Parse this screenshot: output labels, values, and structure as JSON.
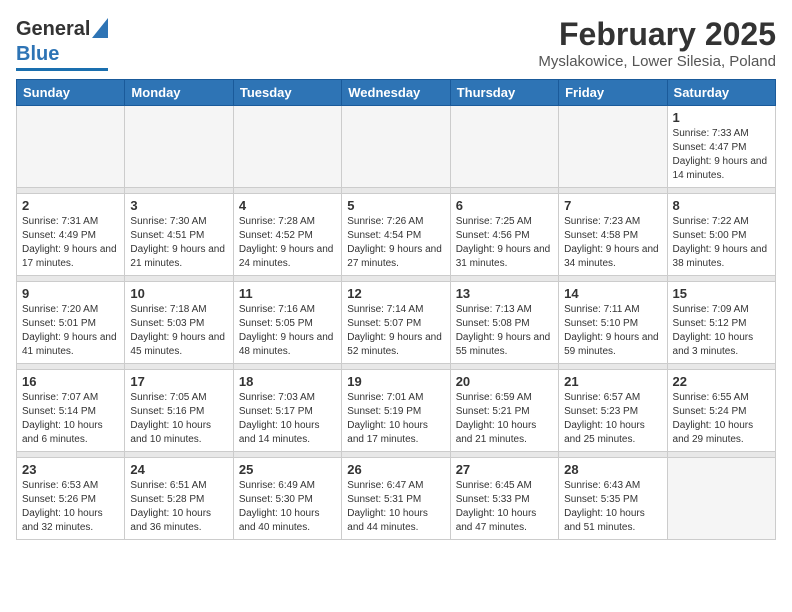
{
  "header": {
    "logo_line1": "General",
    "logo_line2": "Blue",
    "title": "February 2025",
    "subtitle": "Myslakowice, Lower Silesia, Poland"
  },
  "days_of_week": [
    "Sunday",
    "Monday",
    "Tuesday",
    "Wednesday",
    "Thursday",
    "Friday",
    "Saturday"
  ],
  "weeks": [
    [
      {
        "day": "",
        "info": ""
      },
      {
        "day": "",
        "info": ""
      },
      {
        "day": "",
        "info": ""
      },
      {
        "day": "",
        "info": ""
      },
      {
        "day": "",
        "info": ""
      },
      {
        "day": "",
        "info": ""
      },
      {
        "day": "1",
        "info": "Sunrise: 7:33 AM\nSunset: 4:47 PM\nDaylight: 9 hours and 14 minutes."
      }
    ],
    [
      {
        "day": "2",
        "info": "Sunrise: 7:31 AM\nSunset: 4:49 PM\nDaylight: 9 hours and 17 minutes."
      },
      {
        "day": "3",
        "info": "Sunrise: 7:30 AM\nSunset: 4:51 PM\nDaylight: 9 hours and 21 minutes."
      },
      {
        "day": "4",
        "info": "Sunrise: 7:28 AM\nSunset: 4:52 PM\nDaylight: 9 hours and 24 minutes."
      },
      {
        "day": "5",
        "info": "Sunrise: 7:26 AM\nSunset: 4:54 PM\nDaylight: 9 hours and 27 minutes."
      },
      {
        "day": "6",
        "info": "Sunrise: 7:25 AM\nSunset: 4:56 PM\nDaylight: 9 hours and 31 minutes."
      },
      {
        "day": "7",
        "info": "Sunrise: 7:23 AM\nSunset: 4:58 PM\nDaylight: 9 hours and 34 minutes."
      },
      {
        "day": "8",
        "info": "Sunrise: 7:22 AM\nSunset: 5:00 PM\nDaylight: 9 hours and 38 minutes."
      }
    ],
    [
      {
        "day": "9",
        "info": "Sunrise: 7:20 AM\nSunset: 5:01 PM\nDaylight: 9 hours and 41 minutes."
      },
      {
        "day": "10",
        "info": "Sunrise: 7:18 AM\nSunset: 5:03 PM\nDaylight: 9 hours and 45 minutes."
      },
      {
        "day": "11",
        "info": "Sunrise: 7:16 AM\nSunset: 5:05 PM\nDaylight: 9 hours and 48 minutes."
      },
      {
        "day": "12",
        "info": "Sunrise: 7:14 AM\nSunset: 5:07 PM\nDaylight: 9 hours and 52 minutes."
      },
      {
        "day": "13",
        "info": "Sunrise: 7:13 AM\nSunset: 5:08 PM\nDaylight: 9 hours and 55 minutes."
      },
      {
        "day": "14",
        "info": "Sunrise: 7:11 AM\nSunset: 5:10 PM\nDaylight: 9 hours and 59 minutes."
      },
      {
        "day": "15",
        "info": "Sunrise: 7:09 AM\nSunset: 5:12 PM\nDaylight: 10 hours and 3 minutes."
      }
    ],
    [
      {
        "day": "16",
        "info": "Sunrise: 7:07 AM\nSunset: 5:14 PM\nDaylight: 10 hours and 6 minutes."
      },
      {
        "day": "17",
        "info": "Sunrise: 7:05 AM\nSunset: 5:16 PM\nDaylight: 10 hours and 10 minutes."
      },
      {
        "day": "18",
        "info": "Sunrise: 7:03 AM\nSunset: 5:17 PM\nDaylight: 10 hours and 14 minutes."
      },
      {
        "day": "19",
        "info": "Sunrise: 7:01 AM\nSunset: 5:19 PM\nDaylight: 10 hours and 17 minutes."
      },
      {
        "day": "20",
        "info": "Sunrise: 6:59 AM\nSunset: 5:21 PM\nDaylight: 10 hours and 21 minutes."
      },
      {
        "day": "21",
        "info": "Sunrise: 6:57 AM\nSunset: 5:23 PM\nDaylight: 10 hours and 25 minutes."
      },
      {
        "day": "22",
        "info": "Sunrise: 6:55 AM\nSunset: 5:24 PM\nDaylight: 10 hours and 29 minutes."
      }
    ],
    [
      {
        "day": "23",
        "info": "Sunrise: 6:53 AM\nSunset: 5:26 PM\nDaylight: 10 hours and 32 minutes."
      },
      {
        "day": "24",
        "info": "Sunrise: 6:51 AM\nSunset: 5:28 PM\nDaylight: 10 hours and 36 minutes."
      },
      {
        "day": "25",
        "info": "Sunrise: 6:49 AM\nSunset: 5:30 PM\nDaylight: 10 hours and 40 minutes."
      },
      {
        "day": "26",
        "info": "Sunrise: 6:47 AM\nSunset: 5:31 PM\nDaylight: 10 hours and 44 minutes."
      },
      {
        "day": "27",
        "info": "Sunrise: 6:45 AM\nSunset: 5:33 PM\nDaylight: 10 hours and 47 minutes."
      },
      {
        "day": "28",
        "info": "Sunrise: 6:43 AM\nSunset: 5:35 PM\nDaylight: 10 hours and 51 minutes."
      },
      {
        "day": "",
        "info": ""
      }
    ]
  ]
}
